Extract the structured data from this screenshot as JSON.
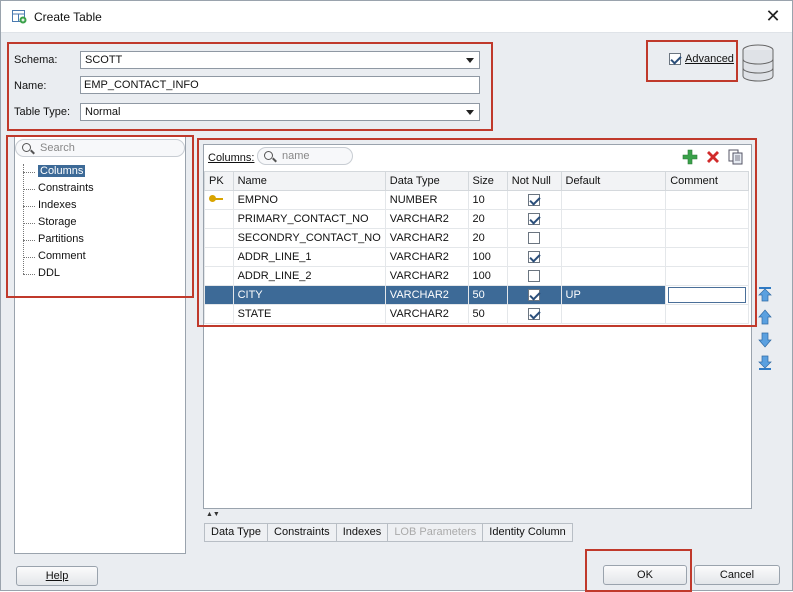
{
  "window": {
    "title": "Create Table"
  },
  "header": {
    "schema_label": "Schema:",
    "schema_value": "SCOTT",
    "name_label": "Name:",
    "name_value": "EMP_CONTACT_INFO",
    "table_type_label": "Table Type:",
    "table_type_value": "Normal",
    "advanced_label": "Advanced",
    "advanced_checked": true
  },
  "sidebar": {
    "search_placeholder": "Search",
    "items": [
      {
        "label": "Columns",
        "selected": true
      },
      {
        "label": "Constraints"
      },
      {
        "label": "Indexes"
      },
      {
        "label": "Storage"
      },
      {
        "label": "Partitions"
      },
      {
        "label": "Comment"
      },
      {
        "label": "DDL"
      }
    ]
  },
  "columns_panel": {
    "label": "Columns:",
    "filter_placeholder": "name",
    "headers": [
      "PK",
      "Name",
      "Data Type",
      "Size",
      "Not Null",
      "Default",
      "Comment"
    ],
    "rows": [
      {
        "pk": true,
        "name": "EMPNO",
        "type": "NUMBER",
        "size": "10",
        "not_null": true,
        "default": "",
        "comment": ""
      },
      {
        "pk": false,
        "name": "PRIMARY_CONTACT_NO",
        "type": "VARCHAR2",
        "size": "20",
        "not_null": true,
        "default": "",
        "comment": ""
      },
      {
        "pk": false,
        "name": "SECONDRY_CONTACT_NO",
        "type": "VARCHAR2",
        "size": "20",
        "not_null": false,
        "default": "",
        "comment": ""
      },
      {
        "pk": false,
        "name": "ADDR_LINE_1",
        "type": "VARCHAR2",
        "size": "100",
        "not_null": true,
        "default": "",
        "comment": ""
      },
      {
        "pk": false,
        "name": "ADDR_LINE_2",
        "type": "VARCHAR2",
        "size": "100",
        "not_null": false,
        "default": "",
        "comment": ""
      },
      {
        "pk": false,
        "name": "CITY",
        "type": "VARCHAR2",
        "size": "50",
        "not_null": true,
        "default": "UP",
        "comment": "",
        "selected": true
      },
      {
        "pk": false,
        "name": "STATE",
        "type": "VARCHAR2",
        "size": "50",
        "not_null": true,
        "default": "",
        "comment": ""
      }
    ],
    "toolbar_icons": [
      "add-icon",
      "delete-icon",
      "copy-icon"
    ],
    "move_icons": [
      "move-top-icon",
      "move-up-icon",
      "move-down-icon",
      "move-bottom-icon"
    ]
  },
  "subtabs": [
    {
      "label": "Data Type"
    },
    {
      "label": "Constraints"
    },
    {
      "label": "Indexes"
    },
    {
      "label": "LOB Parameters",
      "disabled": true
    },
    {
      "label": "Identity Column"
    }
  ],
  "footer": {
    "help_label": "Help",
    "ok_label": "OK",
    "cancel_label": "Cancel"
  },
  "colors": {
    "highlight": "#c0392b",
    "selection": "#3d6a97"
  }
}
